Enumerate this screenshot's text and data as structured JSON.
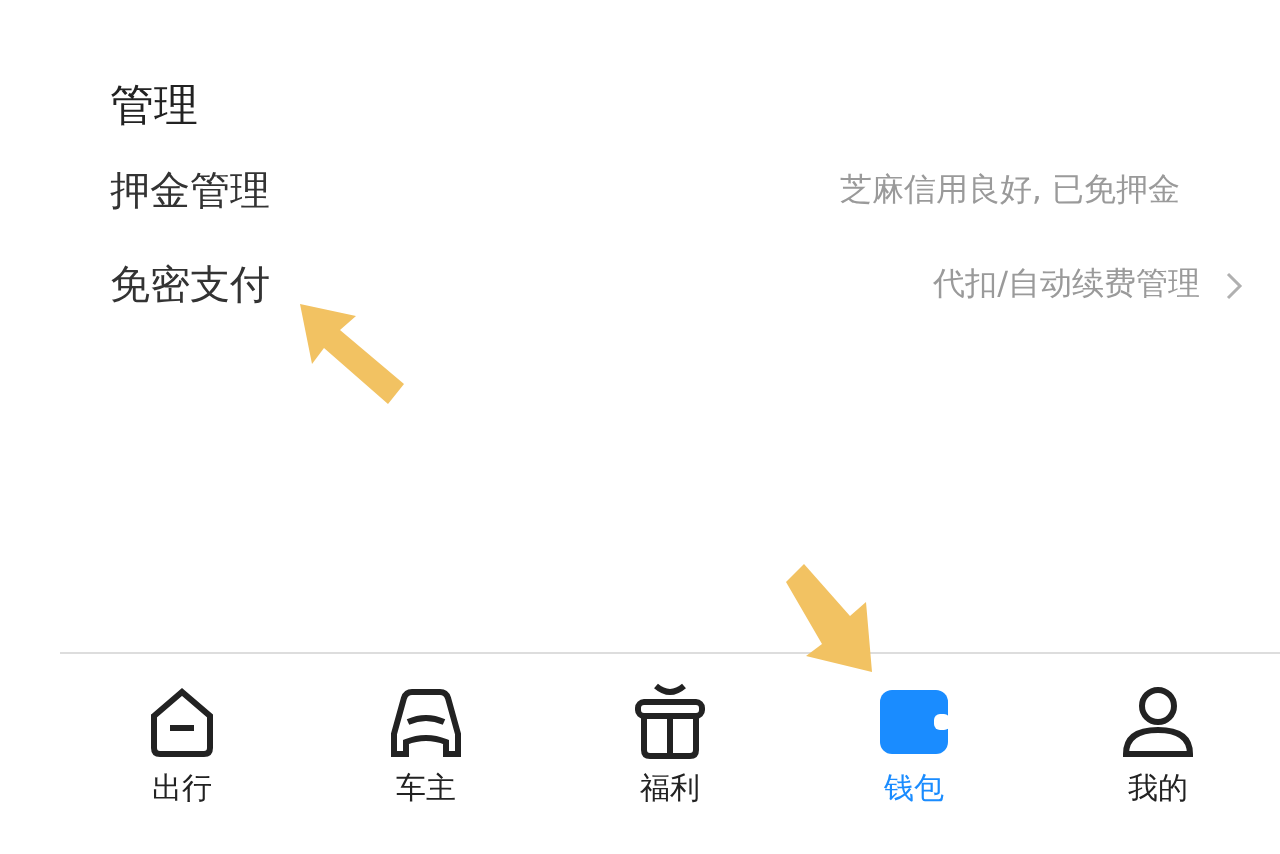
{
  "section": {
    "title": "管理"
  },
  "rows": [
    {
      "label": "押金管理",
      "value": "芝麻信用良好, 已免押金",
      "navigable": false
    },
    {
      "label": "免密支付",
      "value": "代扣/自动续费管理",
      "navigable": true
    }
  ],
  "tab_bar": [
    {
      "label": "出行",
      "selected": false
    },
    {
      "label": "车主",
      "selected": false
    },
    {
      "label": "福利",
      "selected": false
    },
    {
      "label": "钱包",
      "selected": true
    },
    {
      "label": "我的",
      "selected": false
    }
  ]
}
